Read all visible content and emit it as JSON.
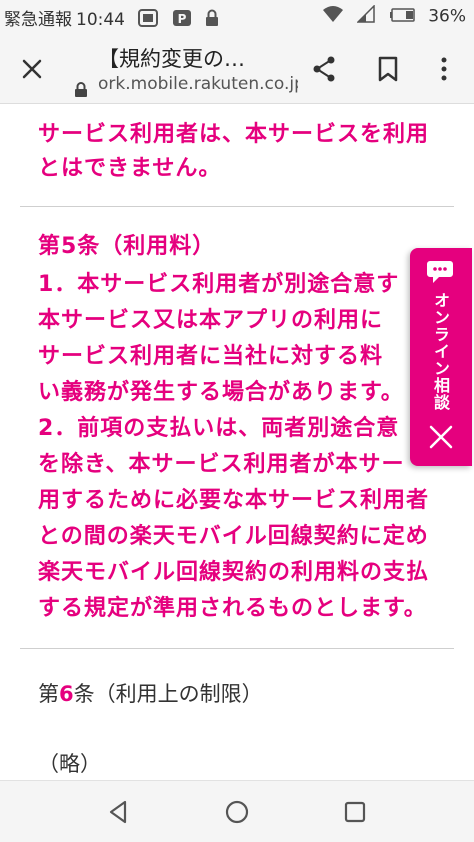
{
  "status_bar": {
    "notification": "緊急通報",
    "time": "10:44",
    "battery": "36%"
  },
  "toolbar": {
    "title": "【規約変更の…",
    "url": "ork.mobile.rakuten.co.jp"
  },
  "content": {
    "top_lines": [
      "サービス利用者は、本サービスを利用",
      "とはできません。"
    ],
    "article5_title": "第5条（利用料）",
    "article5_lines": [
      "1．本サービス利用者が別途合意す",
      "本サービス又は本アプリの利用に",
      "サービス利用者に当社に対する料",
      "い義務が発生する場合があります。",
      "2．前項の支払いは、両者別途合意",
      "を除き、本サービス利用者が本サー",
      "用するために必要な本サービス利用者",
      "との間の楽天モバイル回線契約に定め",
      "楽天モバイル回線契約の利用料の支払",
      "する規定が準用されるものとします。"
    ],
    "article6_prefix": "第",
    "article6_num": "6",
    "article6_rest": "条（利用上の制限）",
    "abbreviated": "（略）"
  },
  "chat_tab": {
    "label": "オンライン相談"
  },
  "colors": {
    "accent": "#e5007e"
  }
}
